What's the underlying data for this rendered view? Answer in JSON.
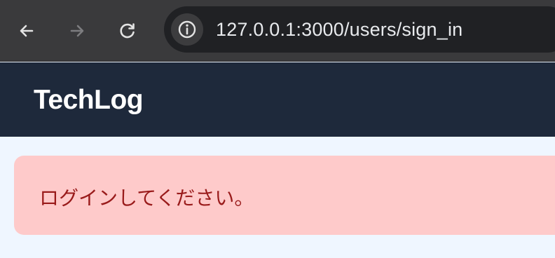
{
  "browser": {
    "url": "127.0.0.1:3000/users/sign_in",
    "icons": {
      "back": "arrow-left-icon",
      "forward": "arrow-right-icon",
      "reload": "reload-icon",
      "site_info": "info-icon"
    }
  },
  "header": {
    "brand": "TechLog"
  },
  "flash": {
    "message": "ログインしてください。"
  },
  "colors": {
    "browser_bar": "#3a3a3c",
    "omnibox": "#202124",
    "header_bg": "#1e293b",
    "page_bg": "#eff6ff",
    "alert_bg": "#fecaca",
    "alert_text": "#991b1b"
  }
}
